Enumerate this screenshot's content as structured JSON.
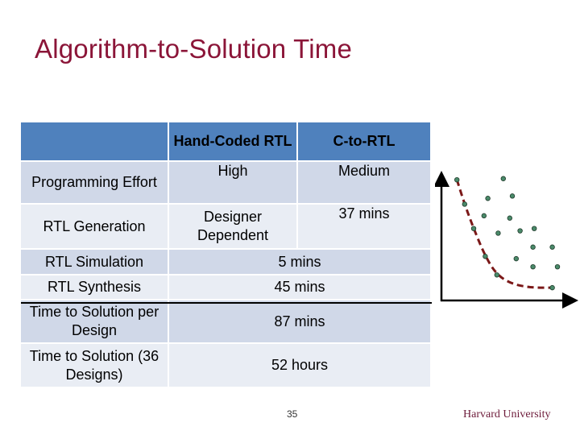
{
  "slide": {
    "title": "Algorithm-to-Solution Time",
    "page_number": "35",
    "footer": "Harvard University",
    "colors": {
      "title": "#8b1538",
      "header_bg": "#4f81bd",
      "row_dark": "#d0d8e8",
      "row_light": "#e9edf4",
      "curve": "#7b1818",
      "points": "#4a8a6a"
    }
  },
  "table": {
    "headers": [
      "",
      "Hand-Coded RTL",
      "C-to-RTL"
    ],
    "rows": [
      {
        "label": "Programming Effort",
        "hand_coded": "High",
        "c_to_rtl": "Medium"
      },
      {
        "label": "RTL Generation",
        "hand_coded": "Designer Dependent",
        "c_to_rtl": "37 mins"
      },
      {
        "label": "RTL Simulation",
        "merged": "5 mins"
      },
      {
        "label": "RTL Synthesis",
        "merged": "45 mins"
      },
      {
        "label": "Time to Solution per Design",
        "merged": "87 mins"
      },
      {
        "label": "Time to Solution (36 Designs)",
        "merged": "52 hours"
      }
    ]
  },
  "diagram": {
    "description": "Scatter of design points with dashed Pareto frontier curve",
    "points": [
      [
        0.12,
        0.95
      ],
      [
        0.48,
        0.96
      ],
      [
        0.36,
        0.79
      ],
      [
        0.55,
        0.81
      ],
      [
        0.18,
        0.74
      ],
      [
        0.33,
        0.64
      ],
      [
        0.53,
        0.62
      ],
      [
        0.25,
        0.53
      ],
      [
        0.44,
        0.49
      ],
      [
        0.61,
        0.51
      ],
      [
        0.72,
        0.53
      ],
      [
        0.71,
        0.37
      ],
      [
        0.86,
        0.37
      ],
      [
        0.34,
        0.29
      ],
      [
        0.58,
        0.27
      ],
      [
        0.71,
        0.2
      ],
      [
        0.9,
        0.2
      ],
      [
        0.43,
        0.13
      ],
      [
        0.86,
        0.02
      ]
    ],
    "frontier": [
      [
        0.12,
        0.95
      ],
      [
        0.18,
        0.74
      ],
      [
        0.25,
        0.53
      ],
      [
        0.34,
        0.29
      ],
      [
        0.43,
        0.13
      ],
      [
        0.55,
        0.05
      ],
      [
        0.7,
        0.02
      ],
      [
        0.86,
        0.02
      ]
    ]
  }
}
